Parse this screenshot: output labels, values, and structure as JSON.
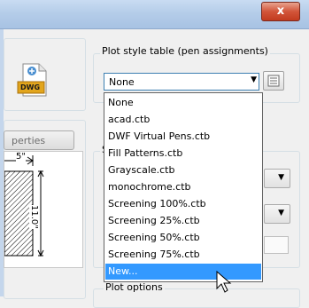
{
  "window": {
    "close_glyph": "x"
  },
  "plot_style_table": {
    "group_label": "Plot style table (pen assignments)",
    "selected_value": "None",
    "options": [
      "None",
      "acad.ctb",
      "DWF Virtual Pens.ctb",
      "Fill Patterns.ctb",
      "Grayscale.ctb",
      "monochrome.ctb",
      "Screening 100%.ctb",
      "Screening 25%.ctb",
      "Screening 50%.ctb",
      "Screening 75%.ctb",
      "New..."
    ],
    "highlighted_option": "New..."
  },
  "left_panel": {
    "file_icon_label": "DWG",
    "properties_button_label": "perties",
    "dimension_width": "5\"",
    "dimension_height": "11.0\""
  },
  "shaded_group_label_fragment": "S",
  "plot_options_label": "Plot options",
  "icons": {
    "dwg-file": "dwg-file-icon",
    "edit": "edit-icon",
    "arrow": "chevron-down-icon",
    "cursor": "mouse-pointer-icon"
  }
}
